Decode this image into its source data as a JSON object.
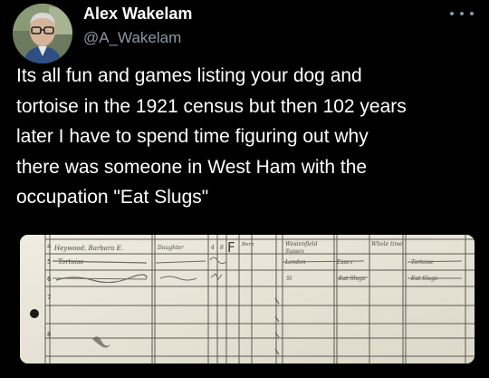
{
  "author": {
    "display_name": "Alex Wakelam",
    "handle": "@A_Wakelam",
    "avatar_icon": "profile-photo-icon"
  },
  "menu_icon": "more-options-icon",
  "tweet": {
    "lines": [
      "Its all fun and games listing your dog and",
      "tortoise in the 1921 census but then 102 years",
      "later I have to spend time figuring out why",
      "there was someone in West Ham with the",
      "occupation \"Eat Slugs\""
    ]
  },
  "census": {
    "row_numbers": [
      "4",
      "5",
      "6",
      "7",
      "8"
    ],
    "entries": {
      "name": "Heywood, Barbara E.",
      "relation": "Daughter",
      "age_a": "4",
      "age_b": "8",
      "sex": "F",
      "status": "Born",
      "birthplace_a": "Westenfield",
      "birthplace_b": "Sussex",
      "birthplace_c": "London",
      "birthplace_d": "Essex",
      "school": "Whole time",
      "occupation_a": "Tortoise",
      "occupation_b": "Eat Slugs",
      "occupation_c": "Eat Slugs",
      "other_name": "Tortoise"
    }
  },
  "colors": {
    "background": "#000000",
    "text": "#ffffff",
    "secondary": "#8b98a5",
    "paper": "#e8e4d4",
    "ink": "#4a4a46",
    "struck_ink": "#7a7a72"
  }
}
